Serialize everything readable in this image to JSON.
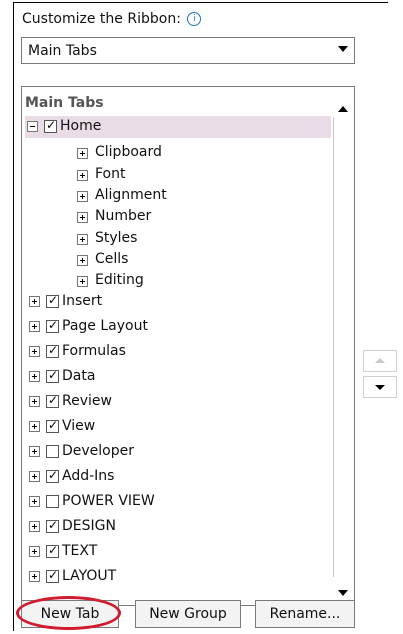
{
  "header": {
    "label": "Customize the Ribbon:",
    "info_icon": "info-icon"
  },
  "dropdown": {
    "selected": "Main Tabs"
  },
  "tree": {
    "header": "Main Tabs",
    "items": [
      {
        "label": "Home",
        "checked": true,
        "expanded": true
      },
      {
        "label": "Insert",
        "checked": true
      },
      {
        "label": "Page Layout",
        "checked": true
      },
      {
        "label": "Formulas",
        "checked": true
      },
      {
        "label": "Data",
        "checked": true
      },
      {
        "label": "Review",
        "checked": true
      },
      {
        "label": "View",
        "checked": true
      },
      {
        "label": "Developer",
        "checked": false
      },
      {
        "label": "Add-Ins",
        "checked": true
      },
      {
        "label": "POWER VIEW",
        "checked": false
      },
      {
        "label": "DESIGN",
        "checked": true
      },
      {
        "label": "TEXT",
        "checked": true
      },
      {
        "label": "LAYOUT",
        "checked": true
      }
    ],
    "home_groups": [
      "Clipboard",
      "Font",
      "Alignment",
      "Number",
      "Styles",
      "Cells",
      "Editing"
    ]
  },
  "buttons": {
    "new_tab": "New Tab",
    "new_group": "New Group",
    "rename": "Rename..."
  },
  "colors": {
    "selected_row_bg": "#eadce6",
    "highlight": "#d11b2f",
    "info": "#1e72c5"
  }
}
